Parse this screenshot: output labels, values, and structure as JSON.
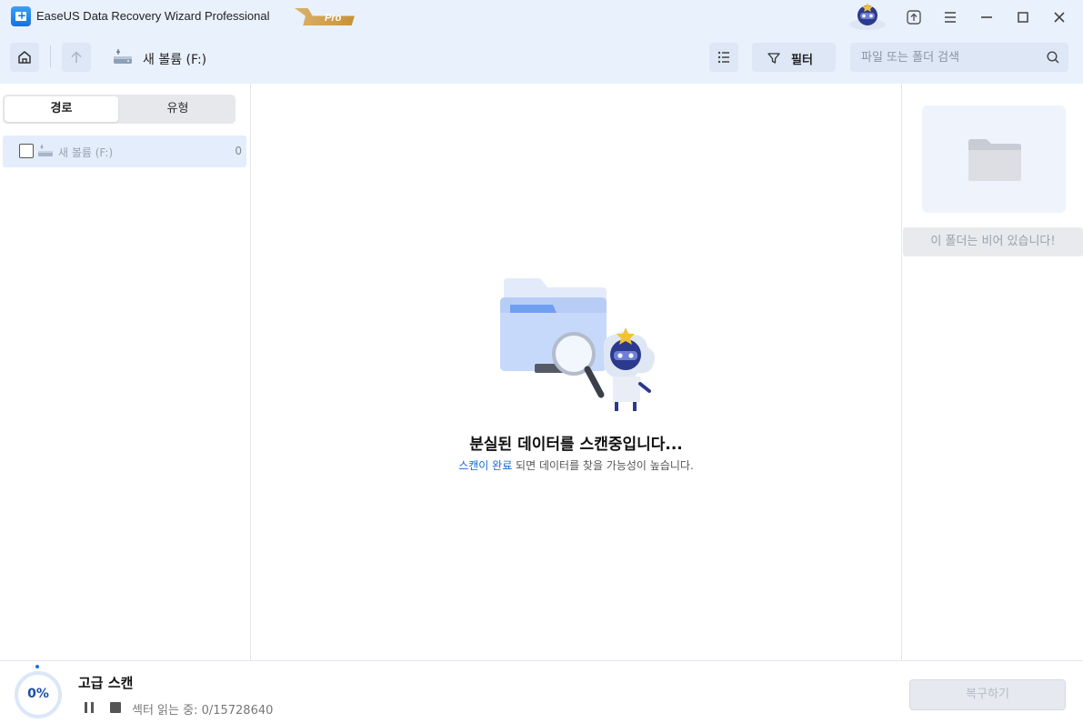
{
  "app": {
    "title": "EaseUS Data Recovery Wizard Professional",
    "badge": "Pro"
  },
  "toolbar": {
    "volume_label": "새 볼륨 (F:)",
    "filter_label": "필터",
    "search_placeholder": "파일 또는 폴더 검색"
  },
  "left_panel": {
    "tabs": [
      {
        "label": "경로",
        "active": true
      },
      {
        "label": "유형",
        "active": false
      }
    ],
    "tree": [
      {
        "label": "새 볼륨 (F:)",
        "count": "0",
        "checked": false
      }
    ]
  },
  "center": {
    "title": "분실된 데이터를 스캔중입니다...",
    "subtitle_link": "스캔이 완료",
    "subtitle_rest": " 되면 데이터를 찾을 가능성이 높습니다."
  },
  "right_panel": {
    "empty_message": "이 폴더는 비어 있습니다!"
  },
  "bottom": {
    "progress_text": "0%",
    "progress_value": 0,
    "scan_title": "고급 스캔",
    "sector_status": "섹터 읽는 중: 0/15728640",
    "recover_label": "복구하기"
  },
  "colors": {
    "header_bg": "#e9f1fd",
    "accent": "#1667d8",
    "selected_row": "#e3edfc"
  }
}
